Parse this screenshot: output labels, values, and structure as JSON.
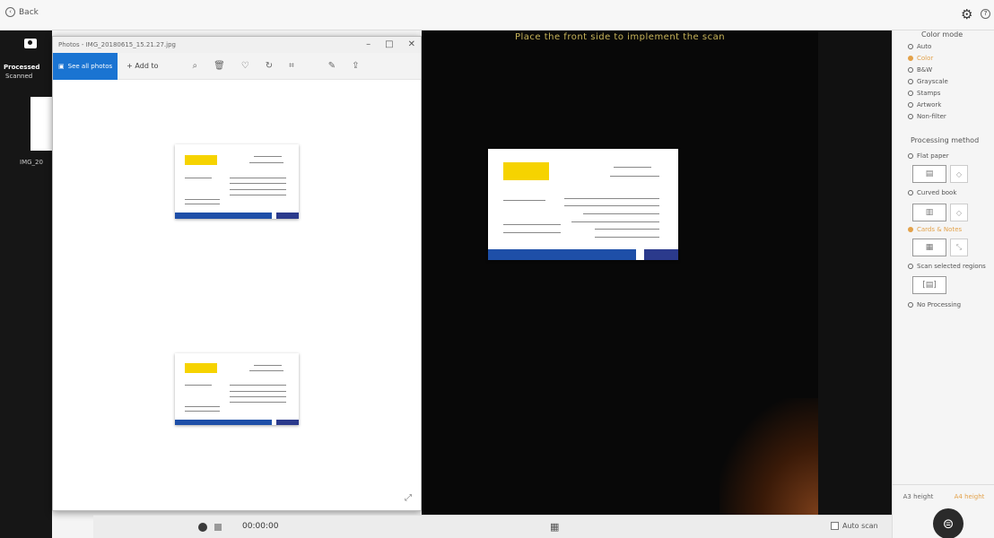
{
  "topbar": {
    "back_label": "Back",
    "back_icon": "circle-arrow-left-icon",
    "settings_icon": "gear-icon",
    "help_icon": "help-icon"
  },
  "left_strip": {
    "tab_processed": "Processed",
    "tab_scanned": "Scanned",
    "thumbnail_label": "IMG_20"
  },
  "photo_window": {
    "title": "Photos - IMG_20180615_15.21.27.jpg",
    "see_all_label": "See all photos",
    "add_label": "Add to",
    "tools": [
      "zoom-in-icon",
      "delete-icon",
      "favorite-icon",
      "rotate-icon",
      "crop-icon",
      "edit-icon",
      "share-icon"
    ]
  },
  "viewer": {
    "instruction": "Place the front side to implement the scan"
  },
  "right_panel": {
    "color_mode_title": "Color mode",
    "color_options": [
      {
        "label": "Auto",
        "selected": false
      },
      {
        "label": "Color",
        "selected": true
      },
      {
        "label": "B&W",
        "selected": false
      },
      {
        "label": "Grayscale",
        "selected": false
      },
      {
        "label": "Stamps",
        "selected": false
      },
      {
        "label": "Artwork",
        "selected": false
      },
      {
        "label": "Non-filter",
        "selected": false
      }
    ],
    "processing_title": "Processing method",
    "processing_options": [
      {
        "label": "Flat paper",
        "selected": false
      },
      {
        "label": "Curved book",
        "selected": false
      },
      {
        "label": "Cards & Notes",
        "selected": true
      },
      {
        "label": "Scan selected regions",
        "selected": false
      },
      {
        "label": "No Processing",
        "selected": false
      }
    ],
    "tabs": [
      "A3 height",
      "A4 height"
    ],
    "scan_button_icon": "scan-icon"
  },
  "bottom_bar": {
    "timer": "00:00:00",
    "auto_scan_label": "Auto scan"
  }
}
